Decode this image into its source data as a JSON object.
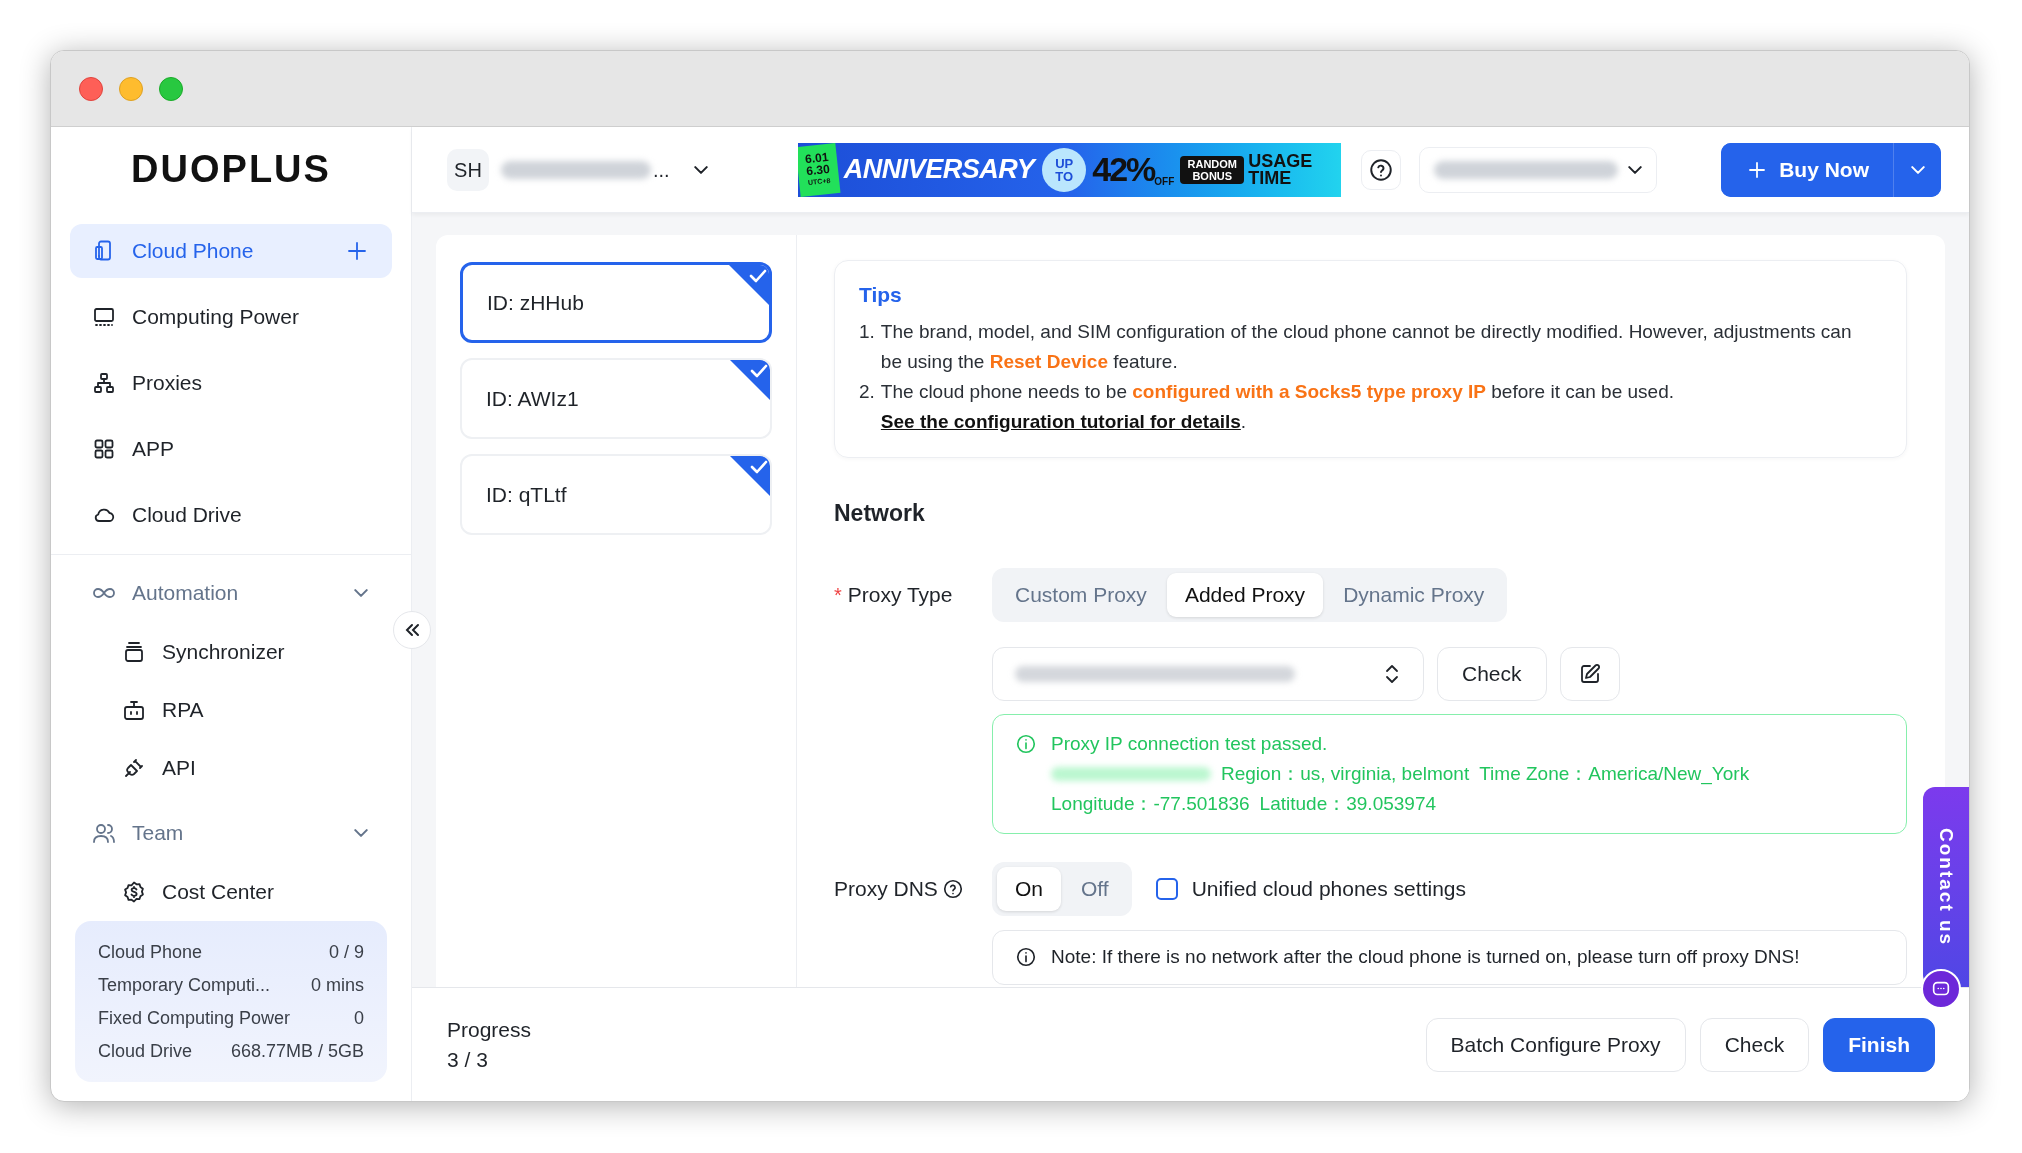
{
  "logo": "DUOPLUS",
  "header": {
    "avatar": "SH",
    "email_suffix": "...",
    "banner": {
      "dates": [
        "6.01",
        "6.30"
      ],
      "zone": "UTC+8",
      "title": "ANNIVERSARY",
      "upto": "UP TO",
      "percent": "42%",
      "off": "OFF",
      "bonus": "RANDOM BONUS",
      "usage": "USAGE TIME"
    },
    "buy": "Buy Now"
  },
  "sidebar": {
    "items": [
      {
        "label": "Cloud Phone",
        "selected": true
      },
      {
        "label": "Computing Power",
        "selected": false
      },
      {
        "label": "Proxies",
        "selected": false
      },
      {
        "label": "APP",
        "selected": false
      },
      {
        "label": "Cloud Drive",
        "selected": false
      }
    ],
    "groups": [
      {
        "label": "Automation",
        "expanded": true,
        "children": [
          {
            "label": "Synchronizer"
          },
          {
            "label": "RPA"
          },
          {
            "label": "API"
          }
        ]
      },
      {
        "label": "Team",
        "expanded": true,
        "children": [
          {
            "label": "Cost Center"
          }
        ]
      }
    ],
    "stats": [
      {
        "label": "Cloud Phone",
        "value": "0 / 9"
      },
      {
        "label": "Temporary Computi...",
        "value": "0 mins"
      },
      {
        "label": "Fixed Computing Power",
        "value": "0"
      },
      {
        "label": "Cloud Drive",
        "value": "668.77MB / 5GB"
      }
    ]
  },
  "devices": [
    {
      "label": "ID: zHHub",
      "selected": true,
      "checked": true
    },
    {
      "label": "ID: AWIz1",
      "selected": false,
      "checked": true
    },
    {
      "label": "ID: qTLtf",
      "selected": false,
      "checked": true
    }
  ],
  "tips": {
    "title": "Tips",
    "items": [
      {
        "number": "1.",
        "text": "The brand, model, and SIM configuration of the cloud phone cannot be directly modified. However, adjustments can be using the **Reset Device** feature."
      },
      {
        "number": "2.",
        "text": "The cloud phone needs to be **configured with a Socks5 type proxy IP** before it can be used.",
        "link": "See the configuration tutorial for details",
        "after": "."
      }
    ]
  },
  "network": {
    "title": "Network",
    "required_mark": "*",
    "proxy_type_label": "Proxy Type",
    "proxy_types": [
      {
        "label": "Custom Proxy",
        "selected": false
      },
      {
        "label": "Added Proxy",
        "selected": true
      },
      {
        "label": "Dynamic Proxy",
        "selected": false
      }
    ],
    "check": "Check",
    "result": {
      "message": "Proxy IP connection test passed.",
      "line2": [
        "Region：us, virginia, belmont",
        "Time Zone：America/New_York"
      ],
      "line3": [
        "Longitude：-77.501836",
        "Latitude：39.053974"
      ]
    },
    "dns_label": "Proxy DNS",
    "dns": [
      {
        "label": "On",
        "selected": true
      },
      {
        "label": "Off",
        "selected": false
      }
    ],
    "unified": {
      "label": "Unified cloud phones settings",
      "checked": false
    },
    "note": "Note: If there is no network after the cloud phone is turned on, please turn off proxy DNS!"
  },
  "contact": "Contact us",
  "footer": {
    "progress_label": "Progress",
    "progress": "3 / 3",
    "buttons": [
      {
        "label": "Batch Configure Proxy",
        "kind": "secondary"
      },
      {
        "label": "Check",
        "kind": "secondary"
      },
      {
        "label": "Finish",
        "kind": "primary"
      }
    ]
  }
}
